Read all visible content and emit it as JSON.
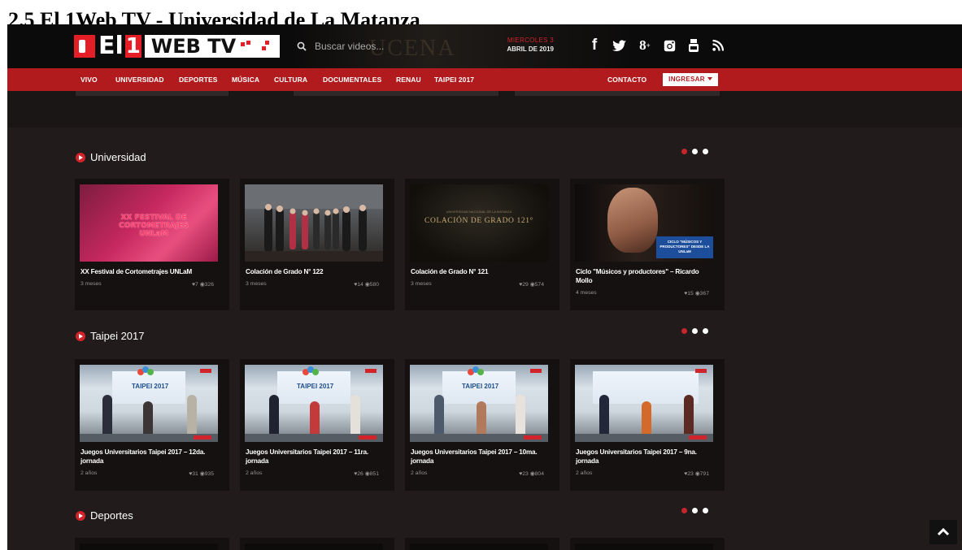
{
  "page_heading": "2.5 El 1Web TV - Universidad de La Matanza",
  "header": {
    "logo_el": "El",
    "logo_one": "1",
    "logo_web": "WEB TV",
    "search_placeholder": "Buscar videos...",
    "date_day": "MIERCOLES 3",
    "date_month": "ABRIL DE 2019",
    "social": [
      {
        "name": "facebook",
        "glyph": "f"
      },
      {
        "name": "twitter",
        "glyph": "t"
      },
      {
        "name": "google-plus",
        "glyph": "8+"
      },
      {
        "name": "instagram",
        "glyph": "ig"
      },
      {
        "name": "youtube",
        "glyph": "yt"
      },
      {
        "name": "rss",
        "glyph": "rss"
      }
    ]
  },
  "nav": {
    "items": [
      "VIVO",
      "UNIVERSIDAD",
      "DEPORTES",
      "MÚSICA",
      "CULTURA",
      "DOCUMENTALES",
      "RENAU",
      "TAIPEI 2017"
    ],
    "contact": "CONTACTO",
    "login": "INGRESAR"
  },
  "sections": [
    {
      "title": "Universidad",
      "cards": [
        {
          "title": "XX Festival de Cortometrajes UNLaM",
          "age": "3 meses",
          "likes": "7",
          "views": "326",
          "thumb_text": "XX FESTIVAL DE CORTOMETRAJES UNLaM"
        },
        {
          "title": "Colación de Grado N° 122",
          "age": "3 meses",
          "likes": "14",
          "views": "580"
        },
        {
          "title": "Colación de Grado N° 121",
          "age": "3 meses",
          "likes": "29",
          "views": "574",
          "thumb_text": "COLACIÓN DE GRADO 121°",
          "thumb_small": "UNIVERSIDAD NACIONAL DE LA MATANZA"
        },
        {
          "title": "Ciclo \"Músicos y productores\" – Ricardo Mollo",
          "age": "4 meses",
          "likes": "15",
          "views": "367",
          "thumb_text": "CICLO \"MÚSICOS Y PRODUCTORES\" DESDE LA UNLaM"
        }
      ]
    },
    {
      "title": "Taipei 2017",
      "cards": [
        {
          "title": "Juegos Universitarios Taipei 2017 – 12da. jornada",
          "age": "2 años",
          "likes": "31",
          "views": "935",
          "thumb_text": "TAIPEI 2017"
        },
        {
          "title": "Juegos Universitarios Taipei 2017 – 11ra. jornada",
          "age": "2 años",
          "likes": "26",
          "views": "851",
          "thumb_text": "TAIPEI 2017"
        },
        {
          "title": "Juegos Universitarios Taipei 2017 – 10ma. jornada",
          "age": "2 años",
          "likes": "23",
          "views": "804",
          "thumb_text": "TAIPEI 2017"
        },
        {
          "title": "Juegos Universitarios Taipei 2017 – 9na. jornada",
          "age": "2 años",
          "likes": "23",
          "views": "791",
          "thumb_text": ""
        }
      ]
    },
    {
      "title": "Deportes",
      "cards": []
    }
  ],
  "colors": {
    "accent": "#b11b1e",
    "dot_active": "#c4262b",
    "background": "#211c1b"
  }
}
